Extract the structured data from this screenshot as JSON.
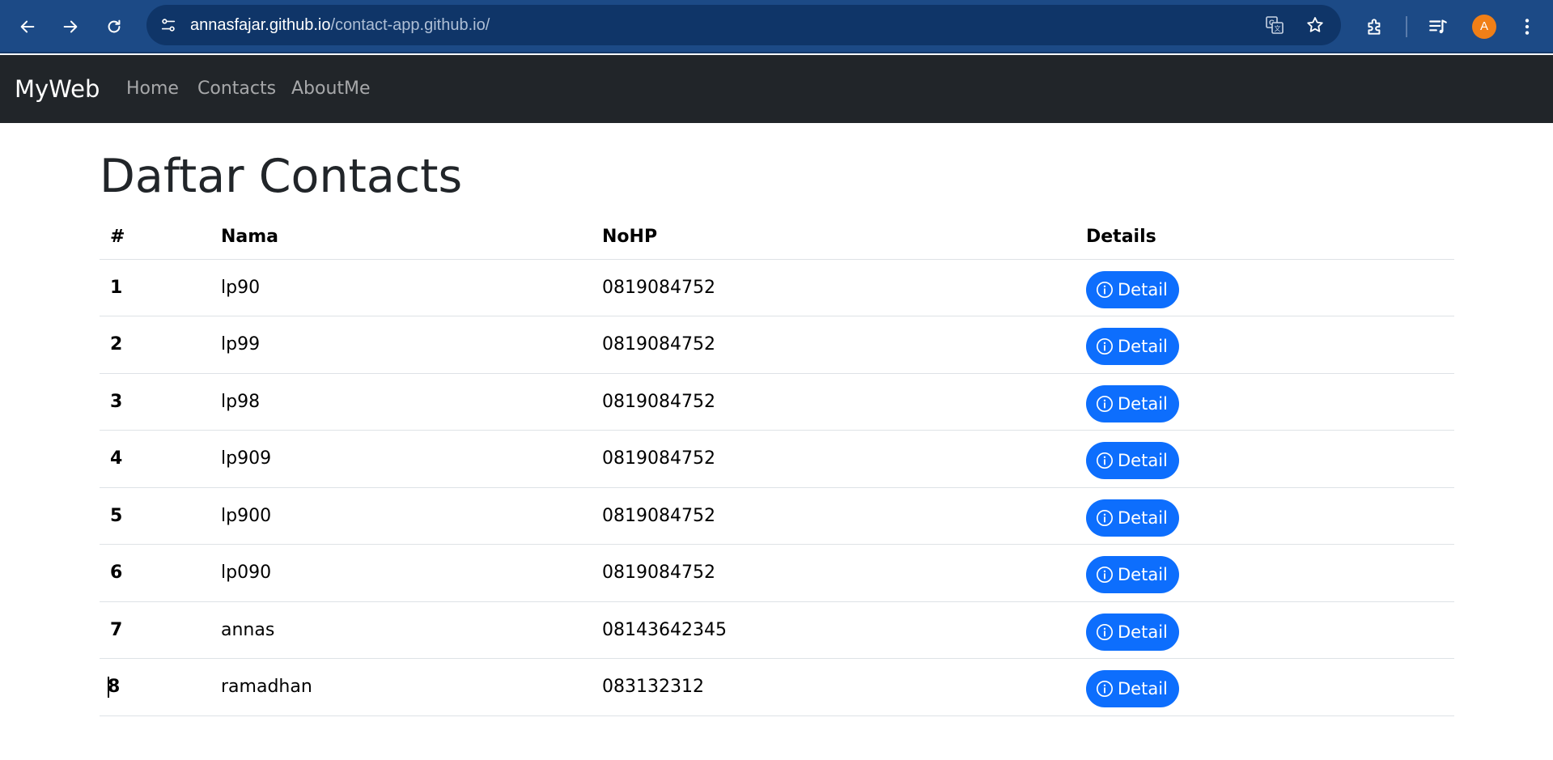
{
  "browser": {
    "url_host": "annasfajar.github.io",
    "url_path": "/contact-app.github.io/",
    "profile_initial": "A",
    "icons": [
      "back-icon",
      "forward-icon",
      "reload-icon",
      "site-info-icon",
      "translate-icon",
      "star-icon",
      "extensions-icon",
      "media-icon",
      "more-icon"
    ],
    "avatar_color": "#f07f17"
  },
  "navbar": {
    "brand": "MyWeb",
    "links": [
      "Home",
      "Contacts",
      "AboutMe"
    ]
  },
  "page": {
    "title": "Daftar Contacts"
  },
  "table": {
    "headers": [
      "#",
      "Nama",
      "NoHP",
      "Details"
    ],
    "rows": [
      {
        "no": "1",
        "nama": "lp90",
        "nohp": "0819084752",
        "action": "Detail"
      },
      {
        "no": "2",
        "nama": "lp99",
        "nohp": "0819084752",
        "action": "Detail"
      },
      {
        "no": "3",
        "nama": "lp98",
        "nohp": "0819084752",
        "action": "Detail"
      },
      {
        "no": "4",
        "nama": "lp909",
        "nohp": "0819084752",
        "action": "Detail"
      },
      {
        "no": "5",
        "nama": "lp900",
        "nohp": "0819084752",
        "action": "Detail"
      },
      {
        "no": "6",
        "nama": "lp090",
        "nohp": "0819084752",
        "action": "Detail"
      },
      {
        "no": "7",
        "nama": "annas",
        "nohp": "08143642345",
        "action": "Detail"
      },
      {
        "no": "8",
        "nama": "ramadhan",
        "nohp": "083132312",
        "action": "Detail"
      }
    ]
  },
  "colors": {
    "navbar_bg": "#212529",
    "browser_bg": "#1c4a86",
    "button_primary": "#0d6efd"
  }
}
